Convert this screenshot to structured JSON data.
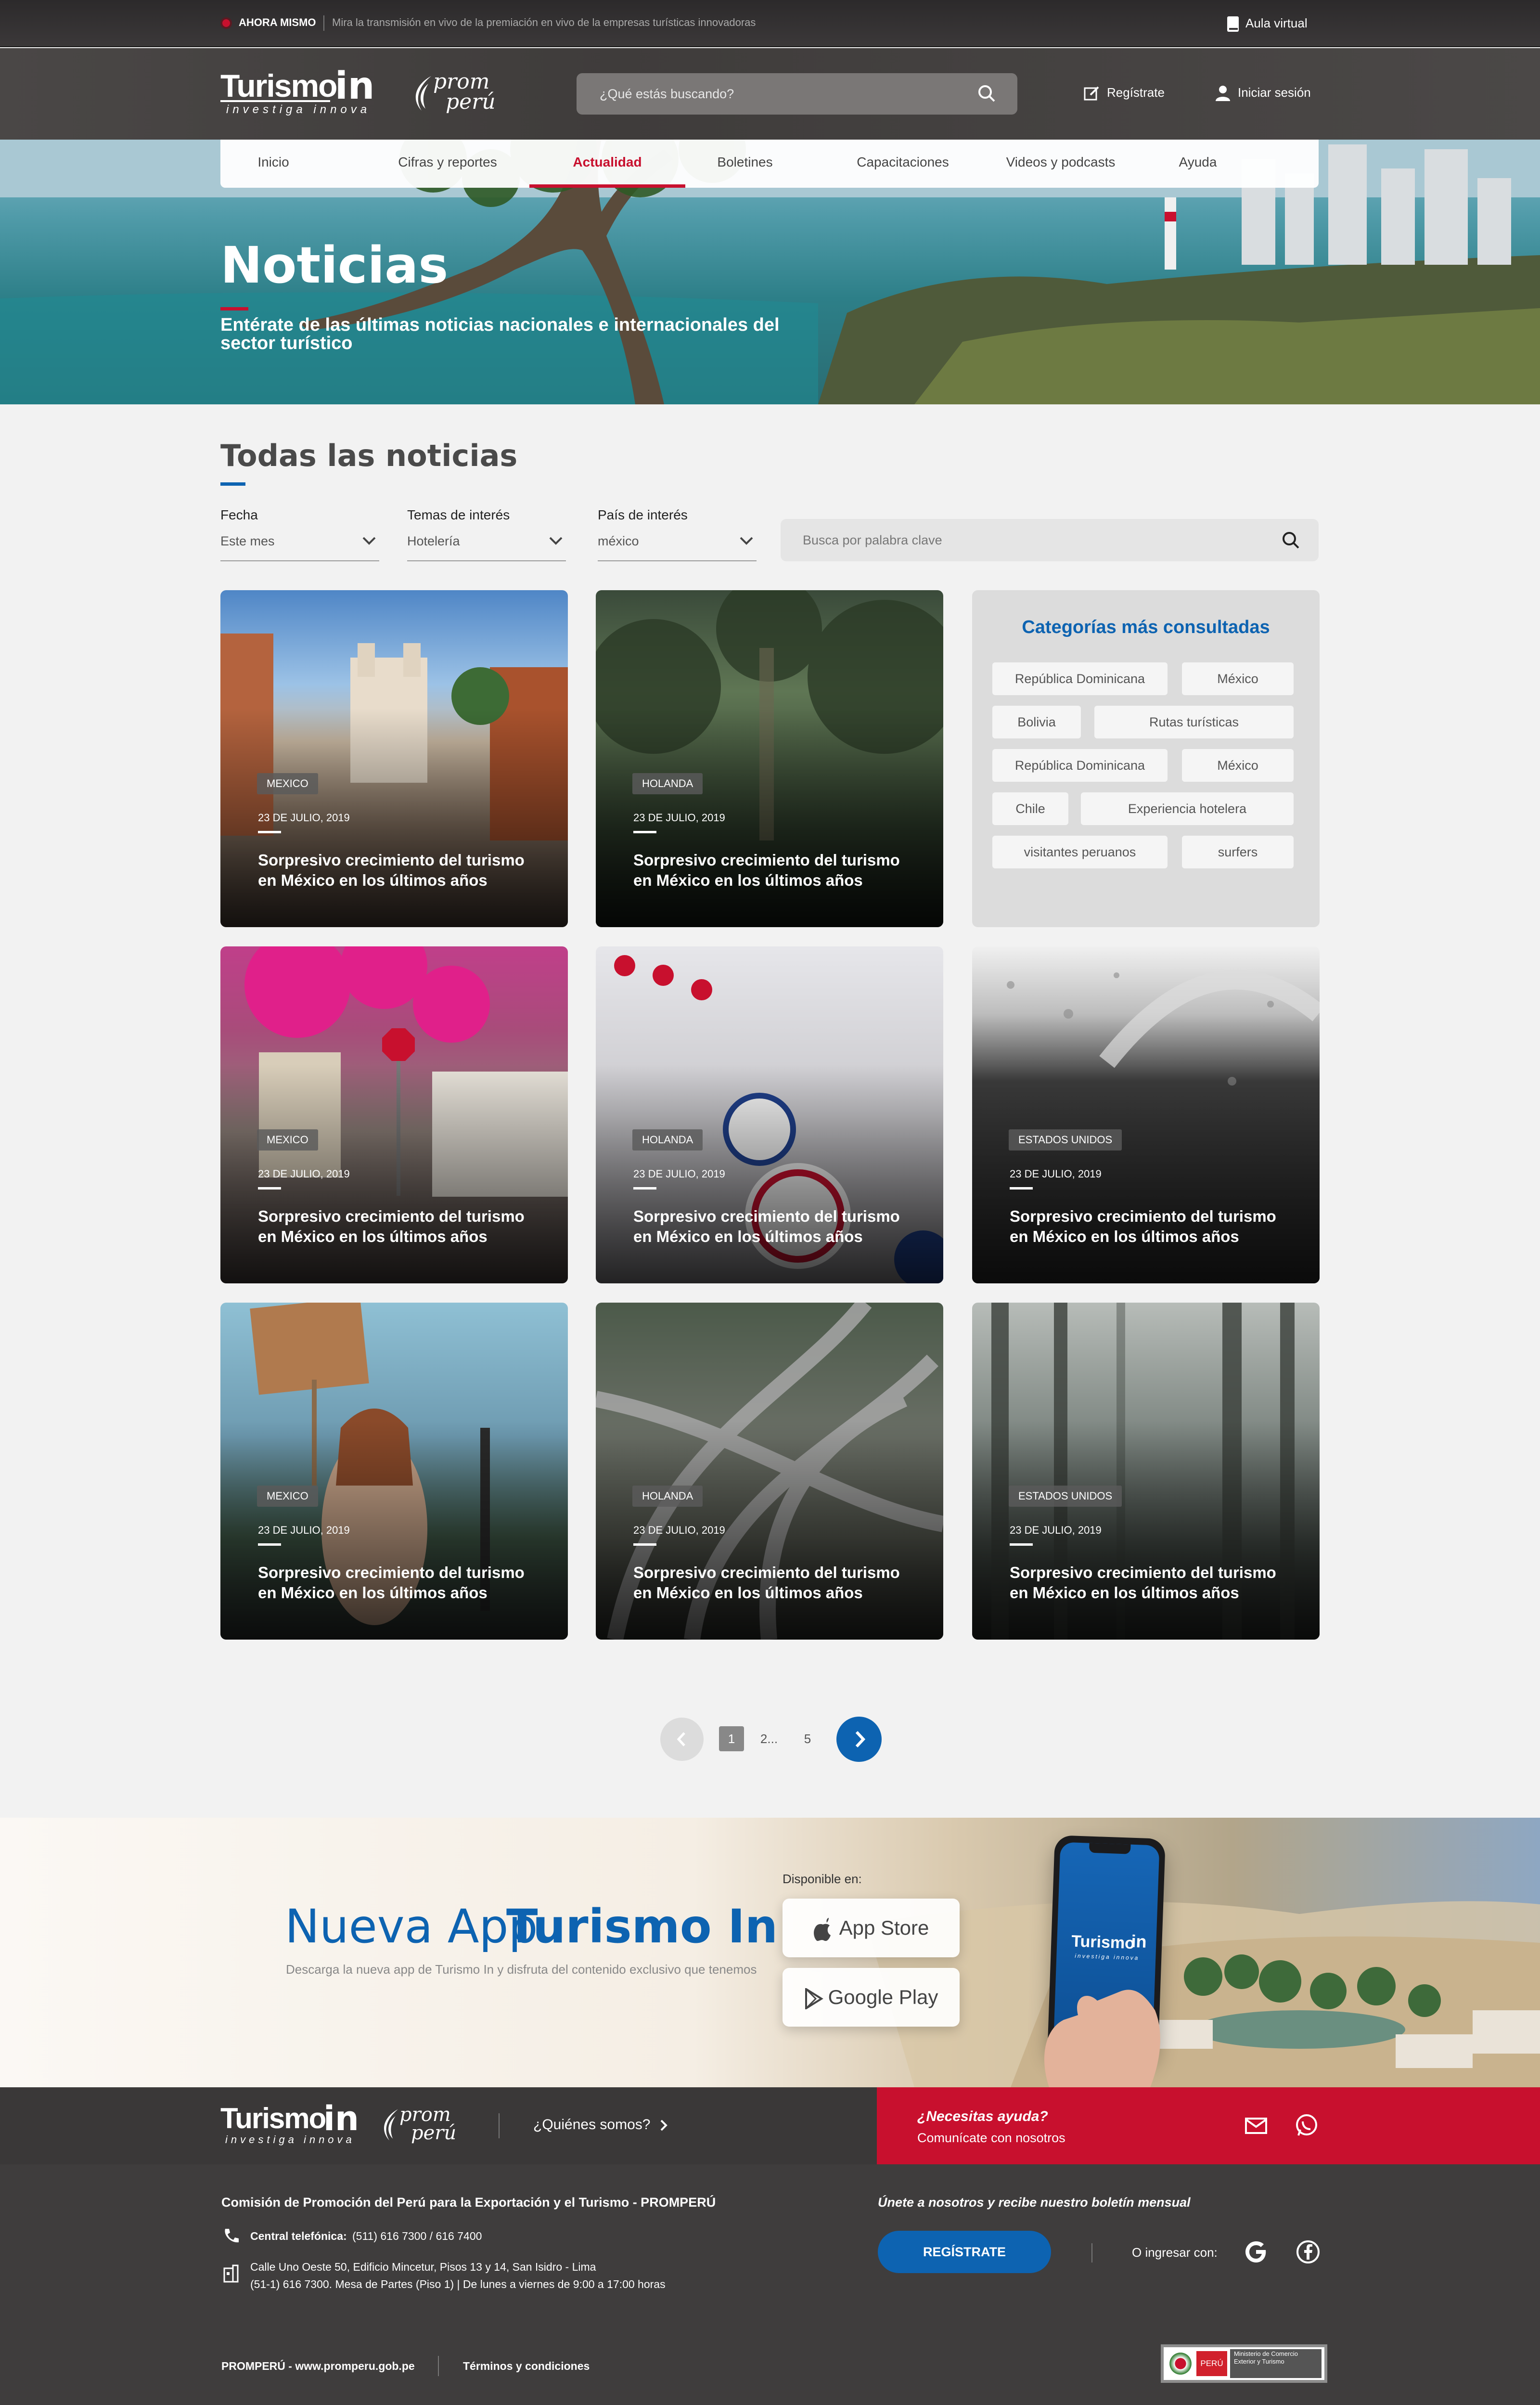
{
  "topbar": {
    "live_label": "AHORA MISMO",
    "live_text": "Mira la transmisión en vivo de la premiación en vivo de la empresas turísticas innovadoras",
    "aula": "Aula virtual"
  },
  "header": {
    "logo_main": "Turismo",
    "logo_in": "in",
    "logo_tag": "investiga innova",
    "promperu_top": "prom",
    "promperu_bottom": "perú",
    "search_placeholder": "¿Qué estás buscando?",
    "register": "Regístrate",
    "login": "Iniciar sesión"
  },
  "nav": [
    "Inicio",
    "Cifras y reportes",
    "Actualidad",
    "Boletines",
    "Capacitaciones",
    "Videos y podcasts",
    "Ayuda"
  ],
  "nav_active": "Actualidad",
  "hero": {
    "title": "Noticias",
    "subtitle": "Entérate de las últimas noticias nacionales e internacionales del sector turístico"
  },
  "news": {
    "heading": "Todas las noticias",
    "filters": [
      {
        "label": "Fecha",
        "value": "Este mes"
      },
      {
        "label": "Temas de interés",
        "value": "Hotelería"
      },
      {
        "label": "País de interés",
        "value": "méxico"
      }
    ],
    "keyword_placeholder": "Busca por palabra clave",
    "cards": [
      {
        "tag": "MEXICO",
        "date": "23 DE JULIO, 2019",
        "title": "Sorpresivo crecimiento del turismo en México en los últimos años"
      },
      {
        "tag": "HOLANDA",
        "date": "23 DE JULIO, 2019",
        "title": "Sorpresivo crecimiento del turismo en México en los últimos años"
      },
      {
        "tag": "MEXICO",
        "date": "23 DE JULIO, 2019",
        "title": "Sorpresivo crecimiento del turismo en México en los últimos años"
      },
      {
        "tag": "HOLANDA",
        "date": "23 DE JULIO, 2019",
        "title": "Sorpresivo crecimiento del turismo en México en los últimos años"
      },
      {
        "tag": "ESTADOS UNIDOS",
        "date": "23 DE JULIO, 2019",
        "title": "Sorpresivo crecimiento del turismo en México en los últimos años"
      },
      {
        "tag": "MEXICO",
        "date": "23 DE JULIO, 2019",
        "title": "Sorpresivo crecimiento del turismo en México en los últimos años"
      },
      {
        "tag": "HOLANDA",
        "date": "23 DE JULIO, 2019",
        "title": "Sorpresivo crecimiento del turismo en México en los últimos años"
      },
      {
        "tag": "ESTADOS UNIDOS",
        "date": "23 DE JULIO, 2019",
        "title": "Sorpresivo crecimiento del turismo en México en los últimos años"
      }
    ]
  },
  "categories": {
    "title": "Categorías más consultadas",
    "items": [
      "República Dominicana",
      "México",
      "Bolivia",
      "Rutas turísticas",
      "República Dominicana",
      "México",
      "Chile",
      "Experiencia hotelera",
      "visitantes peruanos",
      "surfers"
    ]
  },
  "pagination": {
    "pages": [
      "1",
      "2...",
      "5"
    ],
    "current": "1"
  },
  "app": {
    "title_a": "Nueva App",
    "title_b": "Turismo In",
    "desc": "Descarga la nueva app de Turismo In y disfruta del contenido exclusivo que tenemos",
    "available": "Disponible en:",
    "appstore": "App Store",
    "googleplay": "Google Play",
    "phone_logo": "Turismo",
    "phone_in": "in",
    "phone_tag": "investiga innova"
  },
  "footer": {
    "about": "¿Quiénes somos?",
    "help_title": "¿Necesitas ayuda?",
    "help_sub": "Comunícate con nosotros",
    "org": "Comisión de Promoción del Perú para la Exportación y el Turismo - PROMPERÚ",
    "phone_label": "Central telefónica:",
    "phone": "(511) 616 7300 / 616 7400",
    "address1": "Calle Uno Oeste 50, Edificio Mincetur, Pisos 13 y 14, San Isidro - Lima",
    "address2": "(51-1) 616 7300. Mesa de Partes (Piso 1) | De lunes a viernes de 9:00 a 17:00 horas",
    "newsletter": "Únete a nosotros y recibe nuestro boletín mensual",
    "register_btn": "REGÍSTRATE",
    "or_login": "O ingresar con:",
    "site": "PROMPERÚ - www.promperu.gob.pe",
    "terms": "Términos y condiciones",
    "ministry_country": "PERÚ",
    "ministry_name": "Ministerio de Comercio Exterior y Turismo"
  },
  "colors": {
    "accent_red": "#c8102e",
    "brand_blue": "#0d63b1"
  }
}
